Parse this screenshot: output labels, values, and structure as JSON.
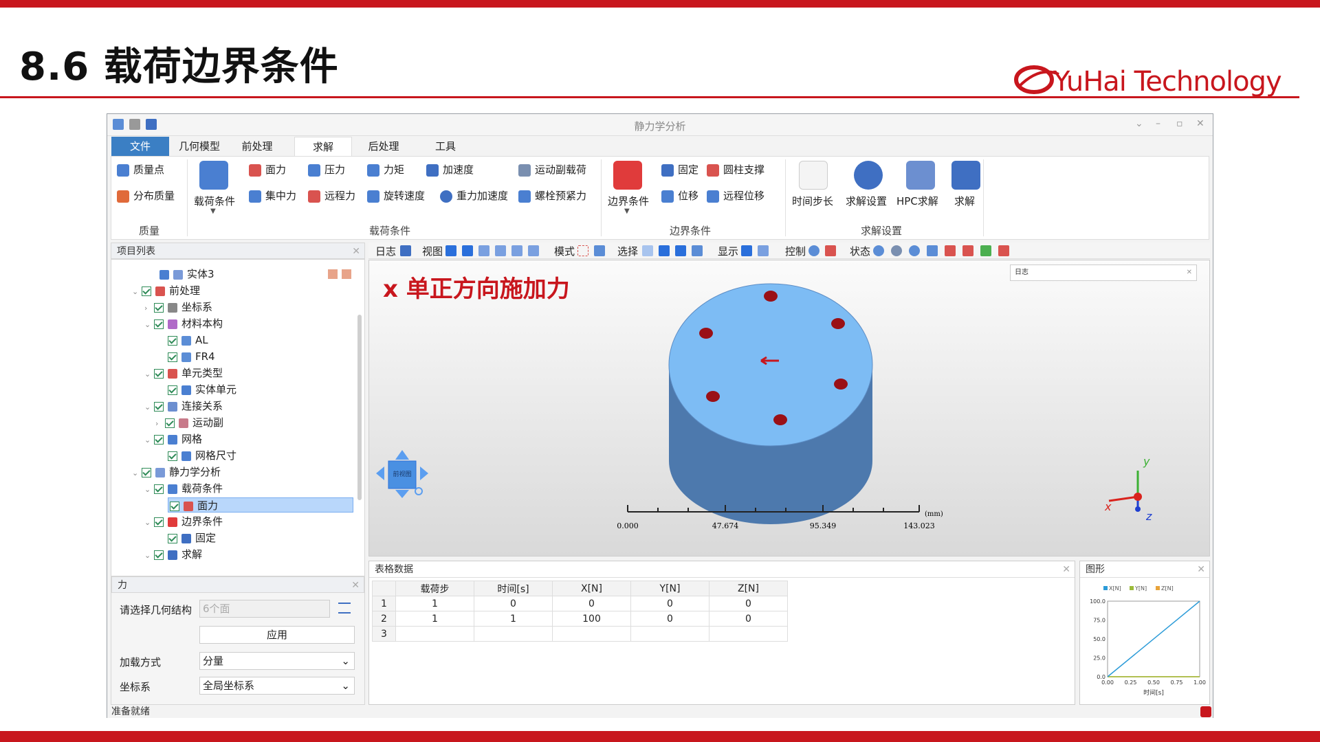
{
  "slide": {
    "title": "8.6 载荷边界条件",
    "logo": "YuHai Technology"
  },
  "app": {
    "window_title": "静力学分析",
    "menus": [
      "文件",
      "几何模型",
      "前处理",
      "求解",
      "后处理",
      "工具"
    ],
    "active_menu": "求解",
    "ribbon": {
      "mass_group": "质量",
      "mass_point": "质量点",
      "dist_mass": "分布质量",
      "load_group": "载荷条件",
      "load_cond": "载荷条件",
      "face_force": "面力",
      "pressure": "压力",
      "moment": "力矩",
      "accel": "加速度",
      "joint_load": "运动副载荷",
      "conc_force": "集中力",
      "remote_force": "远程力",
      "rot_speed": "旋转速度",
      "gravity": "重力加速度",
      "bolt": "螺栓预紧力",
      "bc_group": "边界条件",
      "bc": "边界条件",
      "fixed": "固定",
      "cyl_support": "圆柱支撑",
      "displacement": "位移",
      "remote_disp": "远程位移",
      "solve_group": "求解设置",
      "time_step": "时间步长",
      "solve_setting": "求解设置",
      "hpc": "HPC求解",
      "solve": "求解"
    },
    "toolbar": {
      "log": "日志",
      "view": "视图",
      "mode": "模式",
      "select": "选择",
      "display": "显示",
      "control": "控制",
      "state": "状态"
    },
    "project_panel": {
      "title": "项目列表",
      "items": [
        {
          "label": "实体3"
        },
        {
          "label": "前处理"
        },
        {
          "label": "坐标系"
        },
        {
          "label": "材料本构"
        },
        {
          "label": "AL"
        },
        {
          "label": "FR4"
        },
        {
          "label": "单元类型"
        },
        {
          "label": "实体单元"
        },
        {
          "label": "连接关系"
        },
        {
          "label": "运动副"
        },
        {
          "label": "网格"
        },
        {
          "label": "网格尺寸"
        },
        {
          "label": "静力学分析"
        },
        {
          "label": "载荷条件"
        },
        {
          "label": "面力"
        },
        {
          "label": "边界条件"
        },
        {
          "label": "固定"
        },
        {
          "label": "求解"
        }
      ]
    },
    "props_panel": {
      "title": "力",
      "geom_label": "请选择几何结构",
      "geom_value": "6个面",
      "apply": "应用",
      "load_mode_label": "加载方式",
      "load_mode_value": "分量",
      "cs_label": "坐标系",
      "cs_value": "全局坐标系"
    },
    "viewport": {
      "annotation": "x 单正方向施加力",
      "log_title": "日志",
      "scale_labels": [
        "0.000",
        "47.674",
        "95.349",
        "143.023"
      ],
      "scale_unit": "(mm)",
      "axes": {
        "x": "x",
        "y": "y",
        "z": "z"
      },
      "cube_text": "前视图"
    },
    "table_panel": {
      "title": "表格数据",
      "headers": [
        "载荷步",
        "时间[s]",
        "X[N]",
        "Y[N]",
        "Z[N]"
      ],
      "rows": [
        {
          "n": "1",
          "cells": [
            "1",
            "0",
            "0",
            "0",
            "0"
          ]
        },
        {
          "n": "2",
          "cells": [
            "1",
            "1",
            "100",
            "0",
            "0"
          ]
        },
        {
          "n": "3",
          "cells": [
            "",
            "",
            "",
            "",
            ""
          ]
        }
      ]
    },
    "graph_panel": {
      "title": "图形"
    },
    "status": "准备就绪"
  },
  "chart_data": {
    "type": "line",
    "x": [
      0,
      1
    ],
    "series": [
      {
        "name": "X[N]",
        "values": [
          0,
          100
        ],
        "color": "#2b9bd8"
      },
      {
        "name": "Y[N]",
        "values": [
          0,
          0
        ],
        "color": "#9bbb3a"
      },
      {
        "name": "Z[N]",
        "values": [
          0,
          0
        ],
        "color": "#e8a33a"
      }
    ],
    "xlabel": "时间[s]",
    "ylabel": "",
    "xlim": [
      0,
      1
    ],
    "ylim": [
      0,
      100
    ],
    "xticks": [
      "0.00",
      "0.25",
      "0.50",
      "0.75",
      "1.00"
    ],
    "yticks": [
      "0.0",
      "25.0",
      "50.0",
      "75.0",
      "100.0"
    ],
    "legend": "top"
  }
}
